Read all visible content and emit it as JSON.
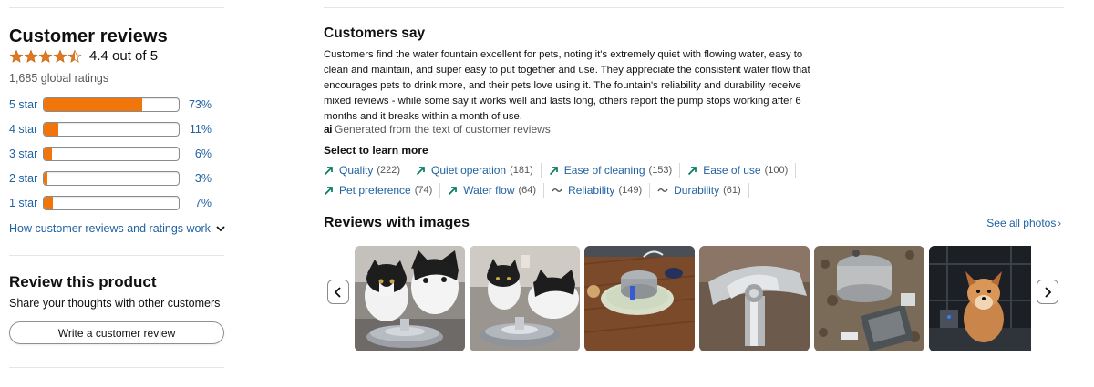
{
  "reviews": {
    "title": "Customer reviews",
    "rating_text": "4.4 out of 5",
    "rating_value": 4.4,
    "global_ratings": "1,685 global ratings",
    "histogram": [
      {
        "label": "5 star",
        "percent": "73%",
        "value": 73
      },
      {
        "label": "4 star",
        "percent": "11%",
        "value": 11
      },
      {
        "label": "3 star",
        "percent": "6%",
        "value": 6
      },
      {
        "label": "2 star",
        "percent": "3%",
        "value": 3
      },
      {
        "label": "1 star",
        "percent": "7%",
        "value": 7
      }
    ],
    "how_link": "How customer reviews and ratings work",
    "star_color": "#de7921",
    "bar_color": "#f0750a"
  },
  "review_product": {
    "title": "Review this product",
    "subtitle": "Share your thoughts with other customers",
    "button_label": "Write a customer review"
  },
  "customers_say": {
    "title": "Customers say",
    "summary": "Customers find the water fountain excellent for pets, noting it's extremely quiet with flowing water, easy to clean and maintain, and super easy to put together and use. They appreciate the consistent water flow that encourages pets to drink more, and their pets love using it. The fountain's reliability and durability receive mixed reviews - while some say it works well and lasts long, others report the pump stops working after 6 months and it breaks within a month of use.",
    "ai_icon": "ai",
    "ai_note": "Generated from the text of customer reviews",
    "select_title": "Select to learn more",
    "chips_row1": [
      {
        "label": "Quality",
        "count": "(222)",
        "icon": "trend-up-icon"
      },
      {
        "label": "Quiet operation",
        "count": "(181)",
        "icon": "trend-up-icon"
      },
      {
        "label": "Ease of cleaning",
        "count": "(153)",
        "icon": "trend-up-icon"
      },
      {
        "label": "Ease of use",
        "count": "(100)",
        "icon": "trend-up-icon"
      }
    ],
    "chips_row2": [
      {
        "label": "Pet preference",
        "count": "(74)",
        "icon": "trend-up-icon"
      },
      {
        "label": "Water flow",
        "count": "(64)",
        "icon": "trend-up-icon"
      },
      {
        "label": "Reliability",
        "count": "(149)",
        "icon": "mixed-wave-icon"
      },
      {
        "label": "Durability",
        "count": "(61)",
        "icon": "mixed-wave-icon"
      }
    ],
    "positive_color": "#067D62"
  },
  "images": {
    "title": "Reviews with images",
    "see_all": "See all photos",
    "see_all_chevron": "›",
    "prev": "‹",
    "next": "›",
    "thumbs": [
      "cats-fountain-photo",
      "cats-drinking-photo",
      "fountain-on-floor-photo",
      "fountain-closeup-photo",
      "fountain-parts-photo",
      "dog-crate-photo"
    ]
  }
}
